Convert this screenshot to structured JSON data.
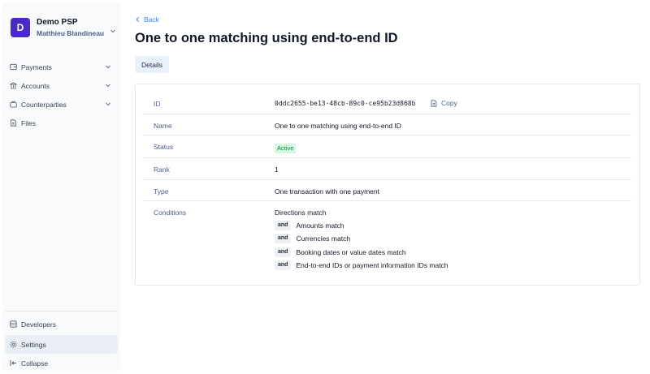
{
  "workspace": {
    "avatar_letter": "D",
    "name": "Demo PSP",
    "user": "Matthieu Blandineau",
    "avatar_color": "#4a2ac9"
  },
  "sidebar": {
    "items": [
      {
        "label": "Payments",
        "icon": "payments-icon",
        "has_chevron": true
      },
      {
        "label": "Accounts",
        "icon": "bank-icon",
        "has_chevron": true
      },
      {
        "label": "Counterparties",
        "icon": "counterparties-icon",
        "has_chevron": true
      },
      {
        "label": "Files",
        "icon": "file-icon",
        "has_chevron": false
      }
    ],
    "bottom": [
      {
        "label": "Developers",
        "icon": "developers-icon"
      },
      {
        "label": "Settings",
        "icon": "gear-icon",
        "active": true
      },
      {
        "label": "Collapse",
        "icon": "collapse-icon"
      }
    ]
  },
  "header": {
    "back_label": "Back",
    "title": "One to one matching using end-to-end ID"
  },
  "tabs": [
    {
      "label": "Details",
      "active": true
    }
  ],
  "details": {
    "id": {
      "label": "ID",
      "value": "0ddc2655-be13-48cb-89c0-ce95b23d868b",
      "copy_label": "Copy"
    },
    "name": {
      "label": "Name",
      "value": "One to one matching using end-to-end ID"
    },
    "status": {
      "label": "Status",
      "value": "Active",
      "color": "#15803d",
      "bg": "#d1fadf"
    },
    "rank": {
      "label": "Rank",
      "value": "1"
    },
    "type": {
      "label": "Type",
      "value": "One transaction with one payment"
    },
    "conditions": {
      "label": "Conditions",
      "first": "Directions match",
      "joiner": "and",
      "rest": [
        "Amounts match",
        "Currencies match",
        "Booking dates or value dates match",
        "End-to-end IDs or payment information IDs match"
      ]
    }
  },
  "colors": {
    "accent_link": "#3b82f6",
    "label_text": "#4b5e8a",
    "tab_bg": "#e9f2fb",
    "active_nav_bg": "#e8edf6"
  }
}
